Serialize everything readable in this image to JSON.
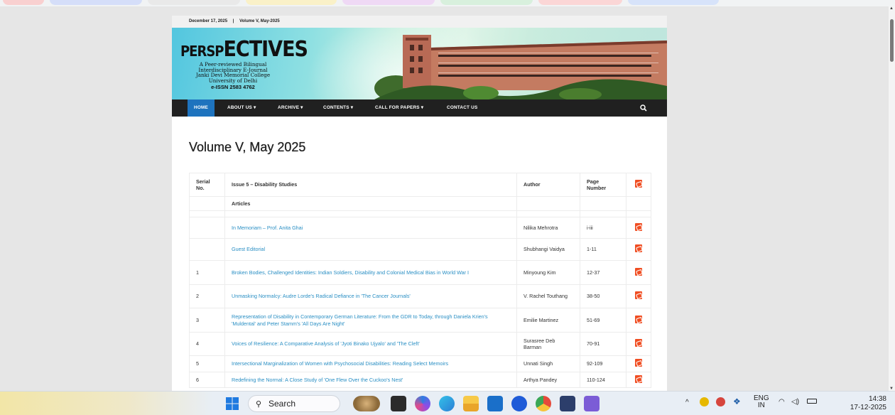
{
  "page": {
    "date": "December 17, 2025",
    "separator": "|",
    "volume_link": "Volume V, May-2025",
    "logo": {
      "word_part1": "PERSP",
      "word_part2": "ECTIVES",
      "line1": "A Peer-reviewed Bilingual",
      "line2": "Interdisciplinary E-Journal",
      "line3": "Janki Devi Memorial College",
      "line4": "University of Delhi",
      "issn": "e-ISSN 2583 4762"
    },
    "nav": [
      {
        "label": "HOME"
      },
      {
        "label": "ABOUT US ▾"
      },
      {
        "label": "ARCHIVE ▾"
      },
      {
        "label": "CONTENTS ▾"
      },
      {
        "label": "CALL FOR PAPERS ▾"
      },
      {
        "label": "CONTACT US"
      }
    ],
    "title": "Volume V, May 2025",
    "table": {
      "headers": {
        "serial": "Serial No.",
        "issue": "Issue 5 – Disability Studies",
        "author": "Author",
        "page": "Page Number"
      },
      "section": "Articles",
      "rows": [
        {
          "serial": "",
          "title": "In Memoriam – Prof. Anita Ghai",
          "author": "Nilika Mehrotra",
          "pages": "i-iii"
        },
        {
          "serial": "",
          "title": "Guest Editorial",
          "author": "Shubhangi Vaidya",
          "pages": "1-11"
        },
        {
          "serial": "1",
          "title": "Broken Bodies, Challenged Identities: Indian Soldiers, Disability and Colonial Medical Bias in World War I",
          "author": "Minyoung Kim",
          "pages": "12-37"
        },
        {
          "serial": "2",
          "title": "Unmasking Normalcy: Audre Lorde's Radical Defiance in 'The Cancer Journals'",
          "author": "V. Rachel Touthang",
          "pages": "38-50"
        },
        {
          "serial": "3",
          "title": "Representation of Disability in Contemporary German Literature: From the GDR to Today, through Daniela Krien's 'Muldental' and Peter Stamm's 'All Days Are Night'",
          "author": "Emilie Martinez",
          "pages": "51-69"
        },
        {
          "serial": "4",
          "title": "Voices of Resilience: A Comparative Analysis of 'Jyoti Binako Ujyalo' and 'The Cleft'",
          "author": "Surasree Deb Barman",
          "pages": "70-91"
        },
        {
          "serial": "5",
          "title": "Intersectional Marginalization of Women with Psychosocial Disabilities: Reading Select Memoirs",
          "author": "Unnati Singh",
          "pages": "92-109"
        },
        {
          "serial": "6",
          "title": "Redefining the Normal: A Close Study of 'One Flew Over the Cuckoo's Nest'",
          "author": "Arthya Pandey",
          "pages": "110-124"
        }
      ]
    }
  },
  "taskbar": {
    "search_placeholder": "Search",
    "language_top": "ENG",
    "language_bottom": "IN",
    "time": "14:38",
    "date": "17-12-2025"
  },
  "colors": {
    "accent": "#1e73be",
    "link": "#2a8fc4",
    "nav_bg": "#202020",
    "pdf": "#f04e23"
  }
}
